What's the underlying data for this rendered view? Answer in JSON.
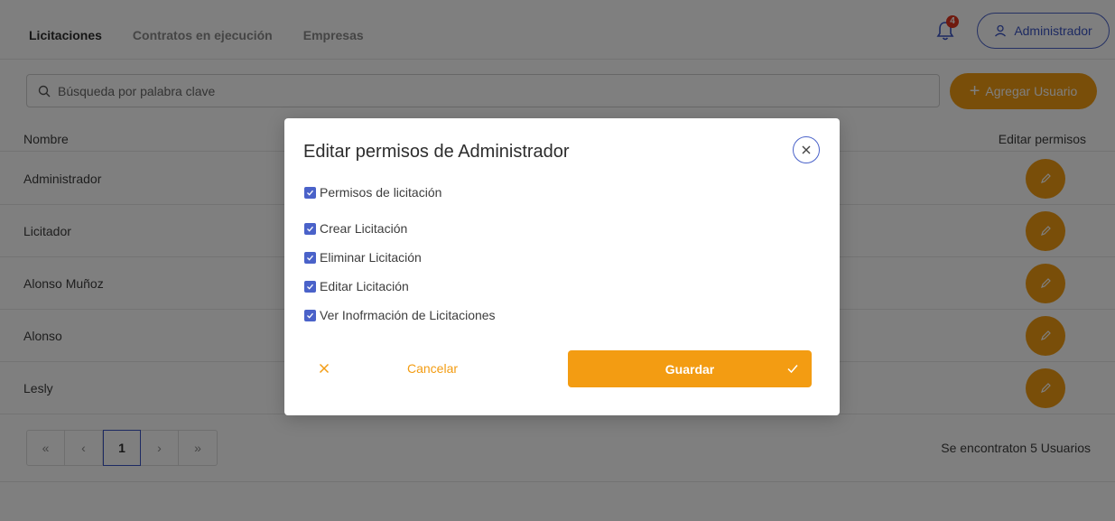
{
  "nav": {
    "tabs": [
      {
        "label": "Licitaciones",
        "active": true
      },
      {
        "label": "Contratos en ejecución",
        "active": false
      },
      {
        "label": "Empresas",
        "active": false
      }
    ],
    "notification_count": "4",
    "user_label": "Administrador"
  },
  "search": {
    "placeholder": "Búsqueda por palabra clave",
    "value": ""
  },
  "add_user_label": "Agregar Usuario",
  "table": {
    "headers": [
      "Nombre",
      "Editar permisos"
    ],
    "rows": [
      "Administrador",
      "Licitador",
      "Alonso Muñoz",
      "Alonso",
      "Lesly"
    ]
  },
  "pagination": {
    "first": "«",
    "prev": "‹",
    "current": "1",
    "next": "›",
    "last": "»"
  },
  "result_count": "Se encontraton 5 Usuarios",
  "modal": {
    "title": "Editar permisos de Administrador",
    "group_label": "Permisos de licitación",
    "permissions": [
      {
        "label": "Crear Licitación",
        "checked": true
      },
      {
        "label": "Eliminar Licitación",
        "checked": true
      },
      {
        "label": "Editar Licitación",
        "checked": true
      },
      {
        "label": "Ver Inofrmación de Licitaciones",
        "checked": true
      }
    ],
    "cancel_label": "Cancelar",
    "save_label": "Guardar"
  },
  "colors": {
    "accent": "#f39c12",
    "primary": "#4a62c9",
    "badge": "#e0341e"
  }
}
